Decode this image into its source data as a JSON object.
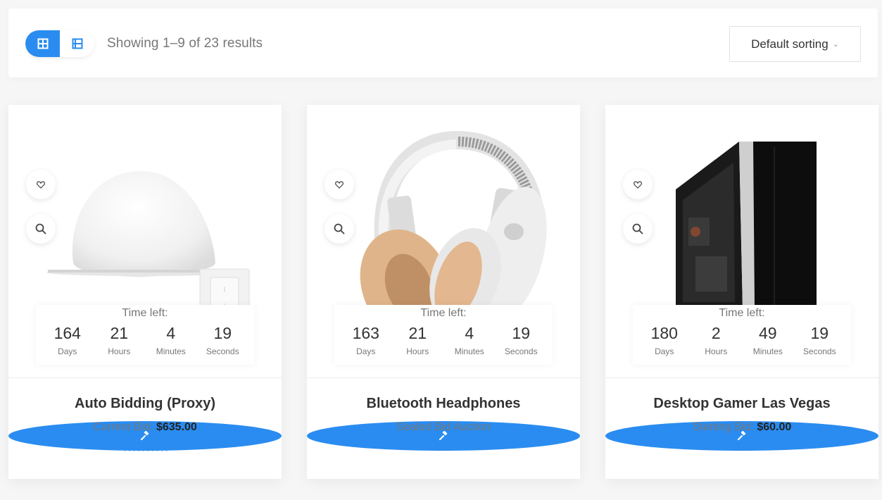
{
  "toolbar": {
    "showing_text": "Showing 1–9 of 23 results",
    "sort_label": "Default sorting",
    "grid_view_icon": "grid-icon",
    "list_view_icon": "list-icon"
  },
  "countdown_heading": "Time left:",
  "countdown_labels": {
    "days": "Days",
    "hours": "Hours",
    "minutes": "Minutes",
    "seconds": "Seconds"
  },
  "products": [
    {
      "title": "Auto Bidding (Proxy)",
      "bid_label": "Current Bid:",
      "bid_value": "$635.00",
      "stars": "★★★★★",
      "rating": 5,
      "countdown": {
        "days": "164",
        "hours": "21",
        "minutes": "4",
        "seconds": "19"
      }
    },
    {
      "title": "Bluetooth Headphones",
      "bid_label": "Sealed Bid Auction",
      "bid_value": "",
      "countdown": {
        "days": "163",
        "hours": "21",
        "minutes": "4",
        "seconds": "19"
      }
    },
    {
      "title": "Desktop Gamer Las Vegas",
      "bid_label": "Starting Bid:",
      "bid_value": "$60.00",
      "countdown": {
        "days": "180",
        "hours": "2",
        "minutes": "49",
        "seconds": "19"
      }
    }
  ],
  "colors": {
    "accent": "#2a8cf0"
  }
}
